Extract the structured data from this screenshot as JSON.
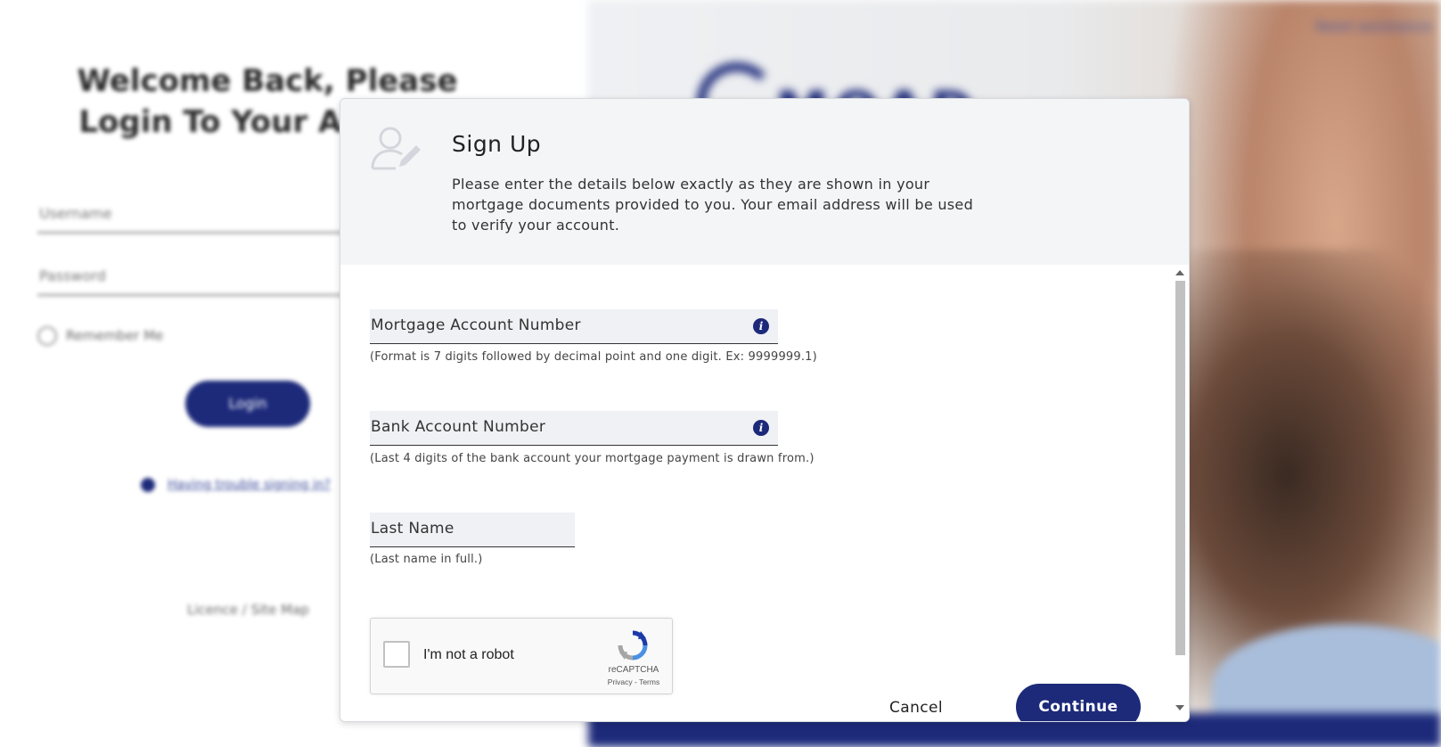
{
  "background": {
    "title": "Welcome Back, Please Login To Your Account",
    "username_placeholder": "Username",
    "password_placeholder": "Password",
    "remember_label": "Remember Me",
    "login_label": "Login",
    "help_link": "Having trouble signing in?",
    "licence_text": "Licence / Site Map",
    "brand": "MOAD",
    "top_link": "Need assistance"
  },
  "modal": {
    "title": "Sign Up",
    "description": "Please enter the details below exactly as they are shown in your mortgage documents provided to you. Your email address will be used to verify your account.",
    "fields": [
      {
        "label": "Mortgage Account Number",
        "hint": "(Format is 7 digits followed by decimal point and one digit. Ex: 9999999.1)",
        "has_info": true
      },
      {
        "label": "Bank Account Number",
        "hint": "(Last 4 digits of the bank account your mortgage payment is drawn from.)",
        "has_info": true
      },
      {
        "label": "Last Name",
        "hint": "(Last name in full.)",
        "has_info": false
      }
    ],
    "captcha": {
      "label": "I'm not a robot",
      "brand": "reCAPTCHA",
      "terms": "Privacy - Terms"
    },
    "cancel_label": "Cancel",
    "continue_label": "Continue",
    "info_glyph": "i"
  },
  "colors": {
    "brand_navy": "#1d2a7a",
    "header_bg": "#f4f5f7",
    "field_bg": "#f0f1f5"
  }
}
